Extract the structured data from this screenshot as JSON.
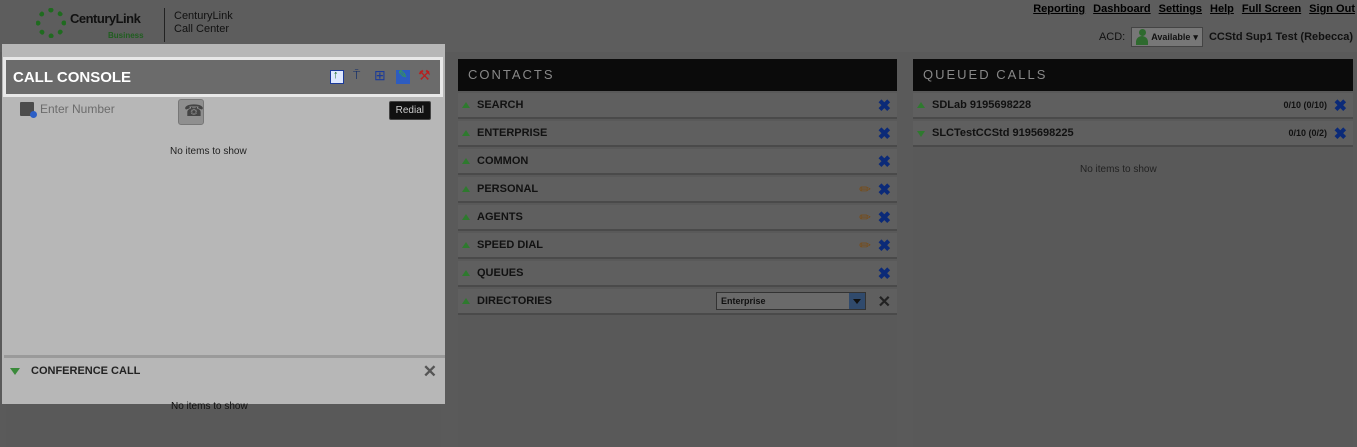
{
  "header": {
    "brand": "CenturyLink",
    "brand_sub": "Business",
    "app_name": "CenturyLink Call Center",
    "links": [
      "Reporting",
      "Dashboard",
      "Settings",
      "Help",
      "Full Screen",
      "Sign Out"
    ],
    "acd_label": "ACD:",
    "acd_status": "Available",
    "user": "CCStd Sup1 Test (Rebecca)"
  },
  "call_console": {
    "title": "CALL CONSOLE",
    "tools": [
      "transfer-icon",
      "push-to-talk-icon",
      "binoculars-icon",
      "notes-icon",
      "settings-tools-icon"
    ],
    "number_placeholder": "Enter Number",
    "redial_label": "Redial",
    "empty_message": "No items to show",
    "conference_title": "CONFERENCE CALL",
    "conference_empty": "No items to show"
  },
  "contacts": {
    "title": "CONTACTS",
    "sections": [
      {
        "label": "SEARCH",
        "editable": false
      },
      {
        "label": "ENTERPRISE",
        "editable": false
      },
      {
        "label": "COMMON",
        "editable": false
      },
      {
        "label": "PERSONAL",
        "editable": true
      },
      {
        "label": "AGENTS",
        "editable": true
      },
      {
        "label": "SPEED DIAL",
        "editable": true
      },
      {
        "label": "QUEUES",
        "editable": false
      },
      {
        "label": "DIRECTORIES",
        "editable": false
      }
    ],
    "directory_value": "Enterprise"
  },
  "queued_calls": {
    "title": "QUEUED CALLS",
    "queues": [
      {
        "label": "SDLab 9195698228",
        "count": "0/10 (0/10)",
        "expanded": false
      },
      {
        "label": "SLCTestCCStd 9195698225",
        "count": "0/10 (0/2)",
        "expanded": true
      }
    ],
    "empty_message": "No items to show"
  }
}
